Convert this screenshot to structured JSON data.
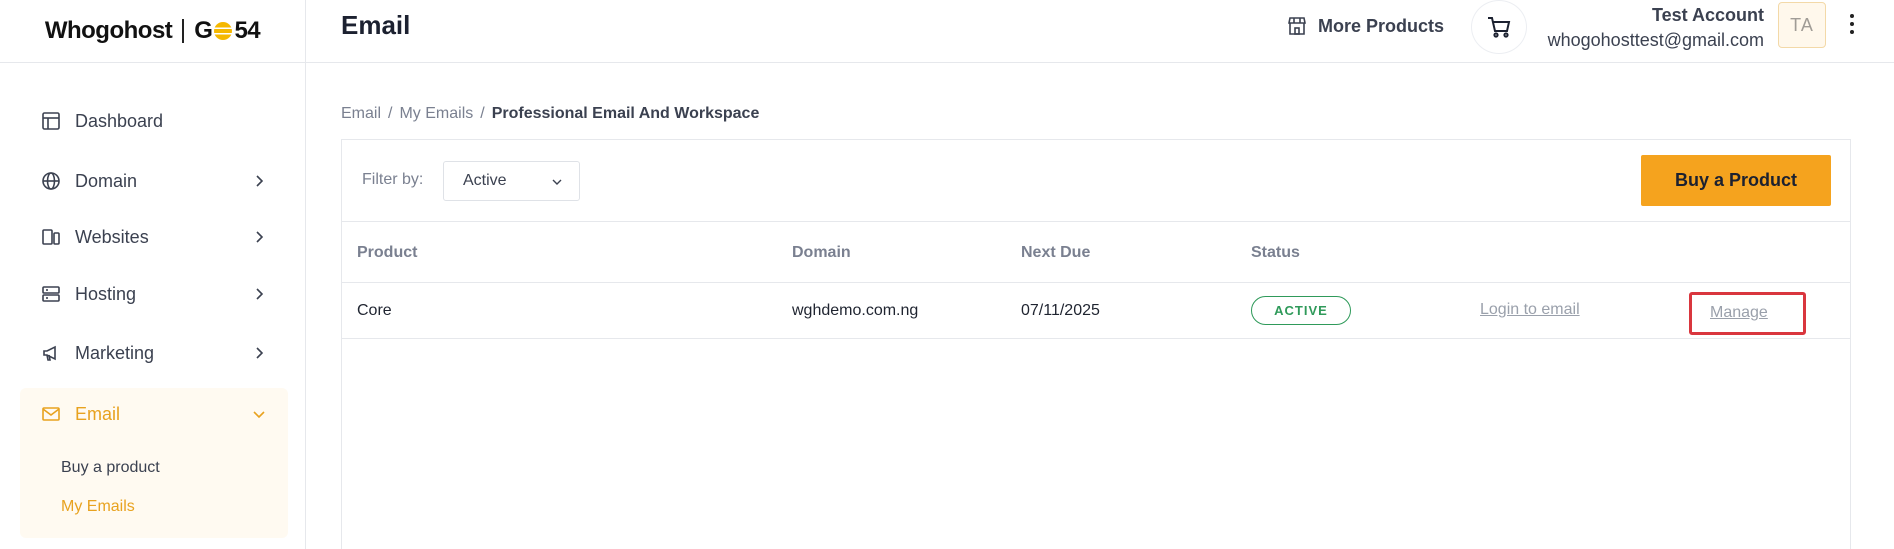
{
  "brand": {
    "logo_text": "Whogohost",
    "partner_prefix": "G",
    "partner_suffix": "54"
  },
  "header": {
    "title": "Email",
    "more_products": "More Products",
    "account_name": "Test Account",
    "account_email": "whogohosttest@gmail.com",
    "avatar_initials": "TA"
  },
  "sidebar": {
    "items": [
      {
        "label": "Dashboard"
      },
      {
        "label": "Domain"
      },
      {
        "label": "Websites"
      },
      {
        "label": "Hosting"
      },
      {
        "label": "Marketing"
      },
      {
        "label": "Email"
      }
    ],
    "email_sub": [
      {
        "label": "Buy a product"
      },
      {
        "label": "My Emails"
      }
    ]
  },
  "breadcrumb": {
    "items": [
      "Email",
      "My Emails"
    ],
    "current": "Professional Email And Workspace",
    "separator": "/"
  },
  "toolbar": {
    "filter_label": "Filter by:",
    "filter_value": "Active",
    "buy_button": "Buy a Product"
  },
  "table": {
    "columns": [
      "Product",
      "Domain",
      "Next Due",
      "Status"
    ],
    "rows": [
      {
        "product": "Core",
        "domain": "wghdemo.com.ng",
        "next_due": "07/11/2025",
        "status": "ACTIVE",
        "login_link": "Login to email",
        "manage_link": "Manage"
      }
    ]
  },
  "colors": {
    "accent": "#f5a31e",
    "active_nav": "#e8a21f",
    "status_green": "#2f9a5a",
    "highlight": "#d9363e"
  }
}
